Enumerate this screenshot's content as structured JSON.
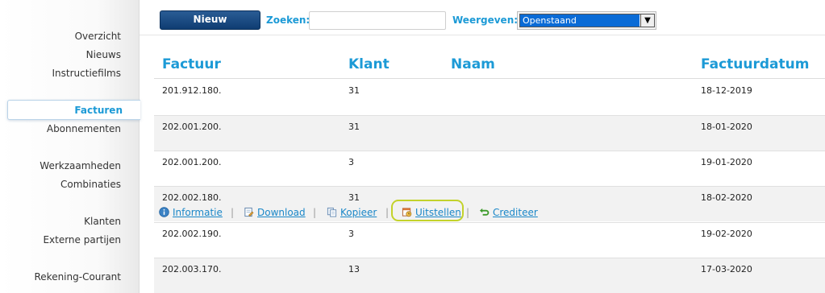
{
  "sidebar": {
    "items": [
      {
        "label": "Overzicht"
      },
      {
        "label": "Nieuws"
      },
      {
        "label": "Instructiefilms"
      },
      {
        "label": "Facturen",
        "active": true
      },
      {
        "label": "Abonnementen"
      },
      {
        "label": "Werkzaamheden"
      },
      {
        "label": "Combinaties"
      },
      {
        "label": "Klanten"
      },
      {
        "label": "Externe partijen"
      },
      {
        "label": "Rekening-Courant"
      }
    ]
  },
  "toolbar": {
    "new_label": "Nieuw",
    "search_label": "Zoeken:",
    "search_value": "",
    "view_label": "Weergeven:",
    "view_selected": "Openstaand"
  },
  "table": {
    "columns": [
      "Factuur",
      "Klant",
      "Naam",
      "Factuurdatum"
    ],
    "rows": [
      {
        "factuur": "201.912.180.",
        "klant": "31",
        "naam": "",
        "datum": "18-12-2019"
      },
      {
        "factuur": "202.001.200.",
        "klant": "31",
        "naam": "",
        "datum": "18-01-2020"
      },
      {
        "factuur": "202.001.200.",
        "klant": "3",
        "naam": "",
        "datum": "19-01-2020"
      },
      {
        "factuur": "202.002.180.",
        "klant": "31",
        "naam": "",
        "datum": "18-02-2020"
      },
      {
        "factuur": "202.002.190.",
        "klant": "3",
        "naam": "",
        "datum": "19-02-2020"
      },
      {
        "factuur": "202.003.170.",
        "klant": "13",
        "naam": "",
        "datum": "17-03-2020"
      }
    ],
    "row_actions": {
      "info": "Informatie",
      "download": "Download",
      "copy": "Kopieer",
      "postpone": "Uitstellen",
      "credit": "Crediteer",
      "separator": "|"
    }
  },
  "colors": {
    "accent": "#1c9ad6",
    "button": "#1a4a80",
    "highlight": "#c3d22b"
  }
}
